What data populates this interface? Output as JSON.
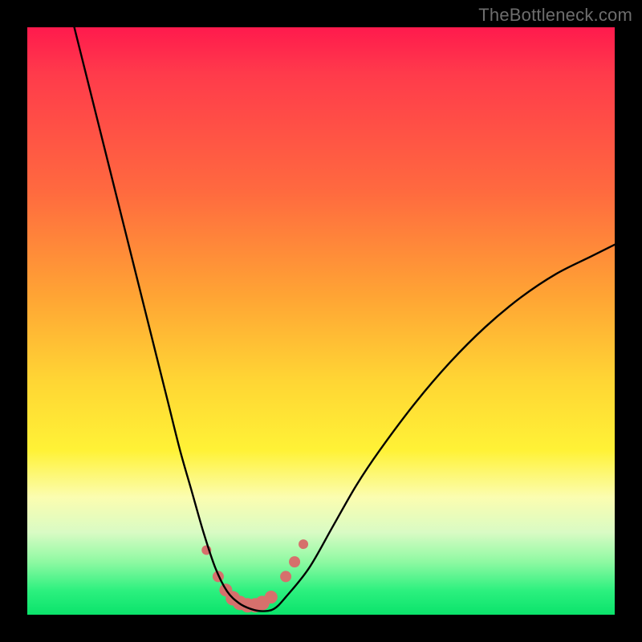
{
  "watermark": "TheBottleneck.com",
  "colors": {
    "frame": "#000000",
    "curve": "#000000",
    "marker": "#d6706c",
    "gradient_top": "#ff1a4d",
    "gradient_bottom": "#0be36b"
  },
  "chart_data": {
    "type": "line",
    "title": "",
    "xlabel": "",
    "ylabel": "",
    "xlim": [
      0,
      100
    ],
    "ylim": [
      0,
      100
    ],
    "series": [
      {
        "name": "bottleneck-curve",
        "x": [
          8,
          10,
          12,
          14,
          16,
          18,
          20,
          22,
          24,
          26,
          28,
          30,
          32,
          34,
          36,
          38,
          40,
          42,
          44,
          48,
          52,
          56,
          60,
          66,
          72,
          78,
          84,
          90,
          96,
          100
        ],
        "y": [
          100,
          92,
          84,
          76,
          68,
          60,
          52,
          44,
          36,
          28,
          21,
          14,
          8,
          4,
          2,
          1,
          0.6,
          1,
          3,
          8,
          15,
          22,
          28,
          36,
          43,
          49,
          54,
          58,
          61,
          63
        ]
      }
    ],
    "markers": {
      "name": "highlight-dots",
      "x": [
        30.5,
        32.5,
        33.8,
        35.0,
        36.2,
        37.5,
        38.8,
        40.0,
        41.5,
        44.0,
        45.5,
        47.0
      ],
      "y": [
        11,
        6.5,
        4.2,
        2.8,
        2.0,
        1.6,
        1.6,
        2.0,
        3.0,
        6.5,
        9.0,
        12
      ],
      "r": [
        6,
        7,
        8,
        9,
        9,
        9,
        9,
        9,
        8,
        7,
        7,
        6
      ]
    }
  }
}
